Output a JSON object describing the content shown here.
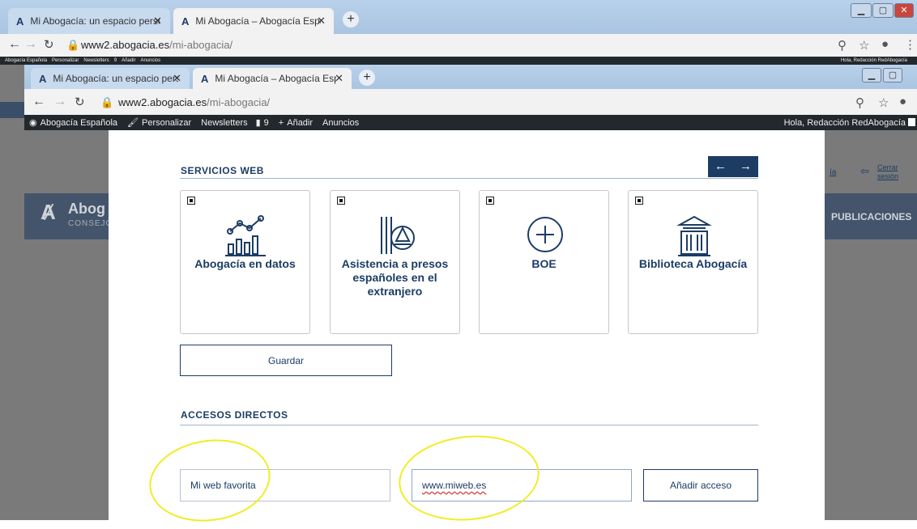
{
  "outer_browser": {
    "tabs": [
      {
        "favicon": "A",
        "title": "Mi Abogacía: un espacio persona",
        "close": "✕"
      },
      {
        "favicon": "A",
        "title": "Mi Abogacía – Abogacía Españo",
        "close": "✕"
      }
    ],
    "new_tab": "+",
    "url_host": "www2.abogacia.es",
    "url_path": "/mi-abogacia/",
    "admin_bar_left": [
      "Abogacía Española",
      "Personalizar",
      "Newsletters",
      "9",
      "Añadir",
      "Anuncios"
    ],
    "admin_bar_right": "Hola, Redacción RedAbogacía"
  },
  "inner_browser": {
    "tabs": [
      {
        "favicon": "A",
        "title": "Mi Abogacía: un espacio persona",
        "close": "✕"
      },
      {
        "favicon": "A",
        "title": "Mi Abogacía – Abogacía Españo",
        "close": "✕"
      }
    ],
    "new_tab": "+",
    "url_host": "www2.abogacia.es",
    "url_path": "/mi-abogacia/",
    "admin_bar": {
      "site": "Abogacía Española",
      "customize": "Personalizar",
      "newsletters": "Newsletters",
      "comments": "9",
      "add": "Añadir",
      "ads": "Anuncios",
      "greeting": "Hola, Redacción RedAbogacía"
    }
  },
  "background_page": {
    "logo_text": "Abog",
    "logo_sub": "CONSEJO",
    "nav_right": "PUBLICACIONES",
    "link_partial": "ía",
    "logout": "Cerrar sesión"
  },
  "modal": {
    "services_title": "SERVICIOS WEB",
    "prev_arrow": "←",
    "next_arrow": "→",
    "cards": [
      {
        "label": "Abogacía en datos",
        "icon": "chart-icon"
      },
      {
        "label": "Asistencia a presos españoles en el extranjero",
        "icon": "prison-icon"
      },
      {
        "label": "BOE",
        "icon": "plus-circle-icon"
      },
      {
        "label": "Biblioteca Abogacía",
        "icon": "library-icon"
      }
    ],
    "save_button": "Guardar",
    "shortcuts_title": "ACCESOS DIRECTOS",
    "shortcut_name_value": "Mi web favorita",
    "shortcut_url_value": "www.miweb.es",
    "add_button": "Añadir acceso"
  },
  "colors": {
    "brand_navy": "#1c3c64",
    "highlight_yellow": "#f2ec23"
  }
}
